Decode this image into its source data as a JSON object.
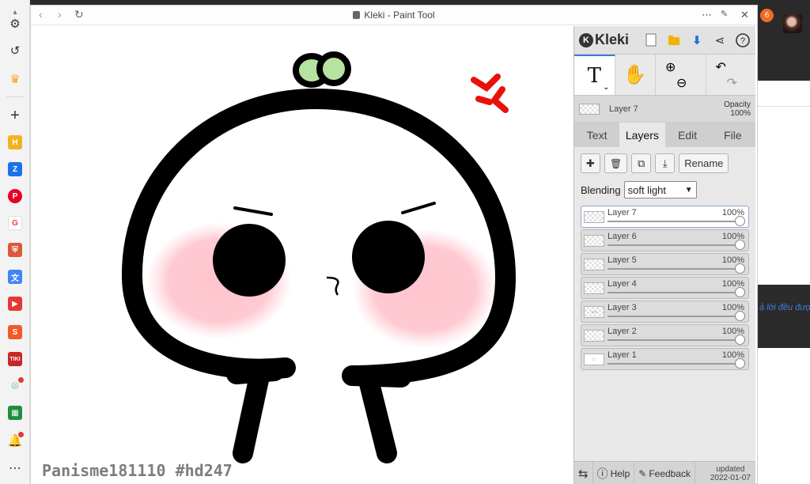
{
  "window": {
    "title": "Kleki - Paint Tool",
    "nav": {
      "back": "‹",
      "forward": "›",
      "reload": "↻"
    },
    "actions": {
      "more": "⋯",
      "pin": "📌",
      "close": "✕"
    }
  },
  "left_sidebar": {
    "items": [
      {
        "name": "settings-icon",
        "glyph": "⚙"
      },
      {
        "name": "history-icon",
        "glyph": "↺"
      },
      {
        "name": "crown-icon",
        "glyph": "♛",
        "color": "#f5a623"
      },
      {
        "name": "add-icon",
        "glyph": "+"
      },
      {
        "name": "h-app-icon",
        "glyph": "H",
        "color": "#f3b321"
      },
      {
        "name": "zalo-icon",
        "glyph": "Z",
        "color": "#1a73e8"
      },
      {
        "name": "pinterest-icon",
        "glyph": "P",
        "color": "#e60023"
      },
      {
        "name": "google-icon",
        "glyph": "G",
        "color": "#ea4335"
      },
      {
        "name": "shield-app-icon",
        "glyph": "⛨",
        "color": "#d95b3a"
      },
      {
        "name": "translate-icon",
        "glyph": "文",
        "color": "#4285f4"
      },
      {
        "name": "video-app-icon",
        "glyph": "▶",
        "color": "#e53935"
      },
      {
        "name": "shopee-icon",
        "glyph": "S",
        "color": "#f05a28"
      },
      {
        "name": "tiki-icon",
        "glyph": "TIKI",
        "color": "#c62828"
      },
      {
        "name": "map-app-icon",
        "glyph": "⌾",
        "color": "#2e9e49"
      },
      {
        "name": "sheets-icon",
        "glyph": "▦",
        "color": "#1e8e3e"
      },
      {
        "name": "bell-icon",
        "glyph": "🔔"
      },
      {
        "name": "more-icon",
        "glyph": "⋯"
      }
    ]
  },
  "canvas": {
    "watermark": "Panisme181110 #hd247"
  },
  "panel": {
    "logo": "Kleki",
    "top_icons": [
      "new-file-icon",
      "open-folder-icon",
      "download-icon",
      "share-icon",
      "help-circle-icon"
    ],
    "tools": {
      "text_tool": "T",
      "hand_tool": "✋",
      "zoom_in": "⊕",
      "zoom_out": "⊖",
      "undo": "↶",
      "redo": "↷"
    },
    "current_layer": {
      "name": "Layer 7",
      "opacity_label": "Opacity",
      "opacity_value": "100%"
    },
    "tabs": [
      {
        "label": "Text"
      },
      {
        "label": "Layers",
        "active": true
      },
      {
        "label": "Edit"
      },
      {
        "label": "File"
      }
    ],
    "layer_buttons": {
      "add": "✚",
      "delete": "🗑",
      "duplicate": "⧉",
      "merge": "⤓",
      "rename": "Rename"
    },
    "blending": {
      "label": "Blending",
      "value": "soft light"
    },
    "layers": [
      {
        "name": "Layer 7",
        "opacity": "100%",
        "active": true,
        "thumb": ""
      },
      {
        "name": "Layer 6",
        "opacity": "100%",
        "thumb": ""
      },
      {
        "name": "Layer 5",
        "opacity": "100%",
        "thumb": ""
      },
      {
        "name": "Layer 4",
        "opacity": "100%",
        "thumb": ""
      },
      {
        "name": "Layer 3",
        "opacity": "100%",
        "thumb": "⋯"
      },
      {
        "name": "Layer 2",
        "opacity": "100%",
        "thumb": ""
      },
      {
        "name": "Layer 1",
        "opacity": "100%",
        "thumb": "◌"
      }
    ],
    "bottom": {
      "swap": "⇆",
      "help": "Help",
      "feedback": "Feedback",
      "updated_label": "updated",
      "updated_date": "2022-01-07"
    }
  },
  "behind": {
    "badge_count": "6",
    "snippet": "ả lời đều đượ"
  }
}
